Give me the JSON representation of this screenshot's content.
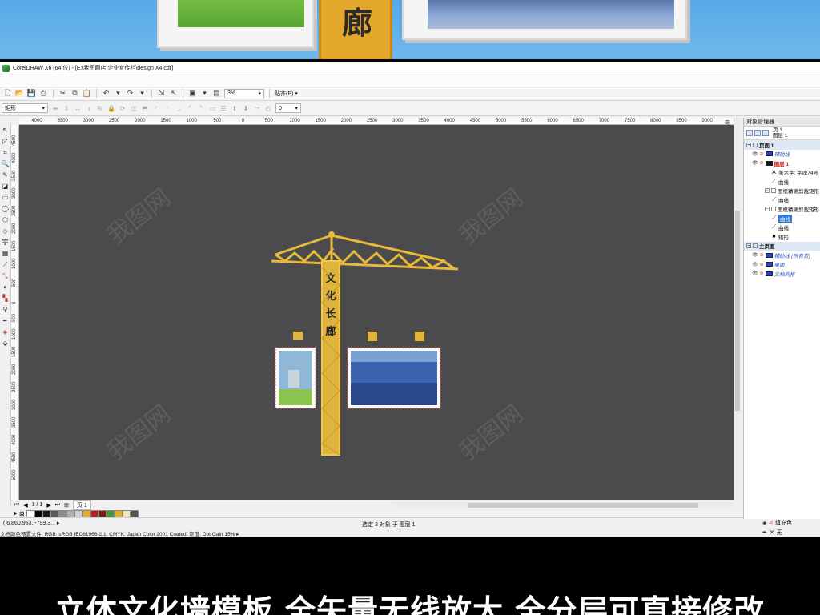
{
  "hero": {
    "post_glyph": "廊"
  },
  "window": {
    "title": "CorelDRAW X6 (64 位) - [E:\\我图网店\\企业宣传栏\\design X4.cdr]"
  },
  "toolbar": {
    "zoom_value": "3%",
    "snap_label": "贴齐(P)"
  },
  "propbar": {
    "object_type": "矩形",
    "rotation_value": "0"
  },
  "ruler": {
    "h_ticks": [
      "4000",
      "3500",
      "3000",
      "2500",
      "2000",
      "1500",
      "1000",
      "500",
      "0",
      "500",
      "1000",
      "1500",
      "2000",
      "2500",
      "3000",
      "3500",
      "4000",
      "4500",
      "5000",
      "5500",
      "6000",
      "6500",
      "7000",
      "7500",
      "8000",
      "8500",
      "9000"
    ],
    "h_unit": "毫米",
    "v_ticks": [
      "4500",
      "4000",
      "3500",
      "3000",
      "2500",
      "2000",
      "1500",
      "1000",
      "500",
      "0",
      "500",
      "1000",
      "1500",
      "2000",
      "2500",
      "3000",
      "3500",
      "4000",
      "4500",
      "5000"
    ]
  },
  "design": {
    "crane_text": [
      "文",
      "化",
      "长",
      "廊"
    ]
  },
  "pagebar": {
    "page_count": "1 / 1",
    "page_tab": "页 1"
  },
  "palette": [
    "#ffffff",
    "#000000",
    "#1a1a1a",
    "#5a5a5a",
    "#8c8c8c",
    "#b0b0b0",
    "#d0d0d0",
    "#e8ab2e",
    "#c01d1d",
    "#7a1a14",
    "#3e9c2f",
    "#e0b020",
    "#f3e8b0",
    "#555555"
  ],
  "status": {
    "coords": "( 6,860.953, -799.3... ▸",
    "selection": "选定 3 对象 于 图层 1",
    "color_profile": "文档颜色预置文件: RGB: sRGB IEC61966-2.1; CMYK: Japan Color 2001 Coated; 灰度: Dot Gain 15% ▸",
    "fill_label": "填充色",
    "outline_label": "无"
  },
  "docker": {
    "title": "对象管理器",
    "crumb_page": "页 1",
    "crumb_layer": "图层 1",
    "rows": [
      {
        "kind": "header",
        "text": "页面 1"
      },
      {
        "kind": "layer",
        "text": "辅助线",
        "style": "blue"
      },
      {
        "kind": "layer",
        "text": "图层 1",
        "style": "red"
      },
      {
        "kind": "obj",
        "icon": "A",
        "text": "美术字: 字魂74号"
      },
      {
        "kind": "obj",
        "icon": "⟋",
        "text": "曲线"
      },
      {
        "kind": "group",
        "text": "图框精确剪裁矩形"
      },
      {
        "kind": "obj",
        "icon": "⟋",
        "text": "曲线"
      },
      {
        "kind": "group",
        "text": "图框精确剪裁矩形"
      },
      {
        "kind": "objsel",
        "icon": "⟋",
        "text": "曲线"
      },
      {
        "kind": "obj",
        "icon": "⟋",
        "text": "曲线"
      },
      {
        "kind": "obj",
        "icon": "■",
        "text": "矩形"
      },
      {
        "kind": "header",
        "text": "主页面"
      },
      {
        "kind": "layer",
        "text": "辅助线 (所有页)",
        "style": "blue"
      },
      {
        "kind": "layer",
        "text": "桌面",
        "style": "blue"
      },
      {
        "kind": "layer",
        "text": "文档网格",
        "style": "blue"
      }
    ]
  },
  "banner": {
    "text": "立体文化墙模板 全矢量无线放大 全分层可直接修改"
  },
  "watermark": "我图网"
}
